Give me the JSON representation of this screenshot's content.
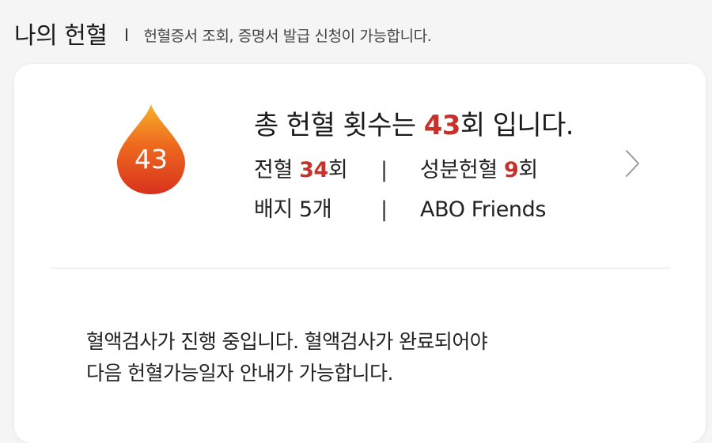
{
  "header": {
    "title": "나의 헌혈",
    "divider": "I",
    "subtitle": "헌혈증서 조회, 증명서 발급 신청이 가능합니다."
  },
  "summary": {
    "drop_count": "43",
    "total_prefix": "총 헌혈 횟수는 ",
    "total_value": "43",
    "total_suffix": "회 입니다.",
    "whole_blood_label": "전혈 ",
    "whole_blood_value": "34",
    "whole_blood_unit": "회",
    "separator": "|",
    "component_label": "성분헌혈 ",
    "component_value": "9",
    "component_unit": "회",
    "badge_label": "배지 5개",
    "badge_group": "ABO Friends",
    "chevron_icon": "chevron-right-icon"
  },
  "notice": {
    "line1": "혈액검사가 진행 중입니다. 혈액검사가 완료되어야",
    "line2": "다음 헌혈가능일자 안내가 가능합니다."
  },
  "colors": {
    "accent": "#c8302a",
    "drop_top": "#f5a623",
    "drop_bottom": "#d9361f",
    "background": "#f5f5f5",
    "card": "#ffffff"
  }
}
